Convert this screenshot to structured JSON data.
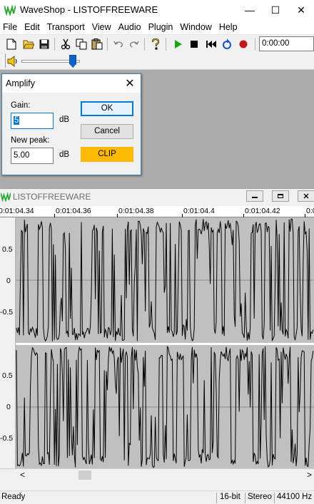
{
  "window": {
    "title": "WaveShop - LISTOFFREEWARE",
    "minimize": "—",
    "maximize": "☐",
    "close": "✕"
  },
  "menu": [
    "File",
    "Edit",
    "Transport",
    "View",
    "Audio",
    "Plugin",
    "Window",
    "Help"
  ],
  "transport": {
    "time": "0:00:00"
  },
  "volume": {
    "level": 0.88
  },
  "dialog": {
    "title": "Amplify",
    "close": "✕",
    "gain_label": "Gain:",
    "gain_value": "5",
    "gain_unit": "dB",
    "new_peak_label": "New peak:",
    "new_peak_value": "5.00",
    "new_peak_unit": "dB",
    "ok": "OK",
    "cancel": "Cancel",
    "clip": "CLIP"
  },
  "document": {
    "title": "LISTOFFREEWARE",
    "ruler": [
      "0:01:04.34",
      "0:01:04.36",
      "0:01:04.38",
      "0:01:04.4",
      "0:01:04.42",
      "0:0"
    ],
    "channels": [
      {
        "ticks": [
          "0.5",
          "0",
          "-0.5"
        ]
      },
      {
        "ticks": [
          "0.5",
          "0",
          "-0.5"
        ]
      }
    ],
    "scroll_left": "<",
    "scroll_right": ">"
  },
  "status": {
    "state": "Ready",
    "bit_depth": "16-bit",
    "channels": "Stereo",
    "sample_rate": "44100 Hz"
  },
  "colors": {
    "accent": "#0078d7",
    "clip": "#ffb900",
    "play": "#1aa61a",
    "record": "#c0181e",
    "waveform_bg": "#c0c0c0",
    "logo": "#2da836"
  }
}
